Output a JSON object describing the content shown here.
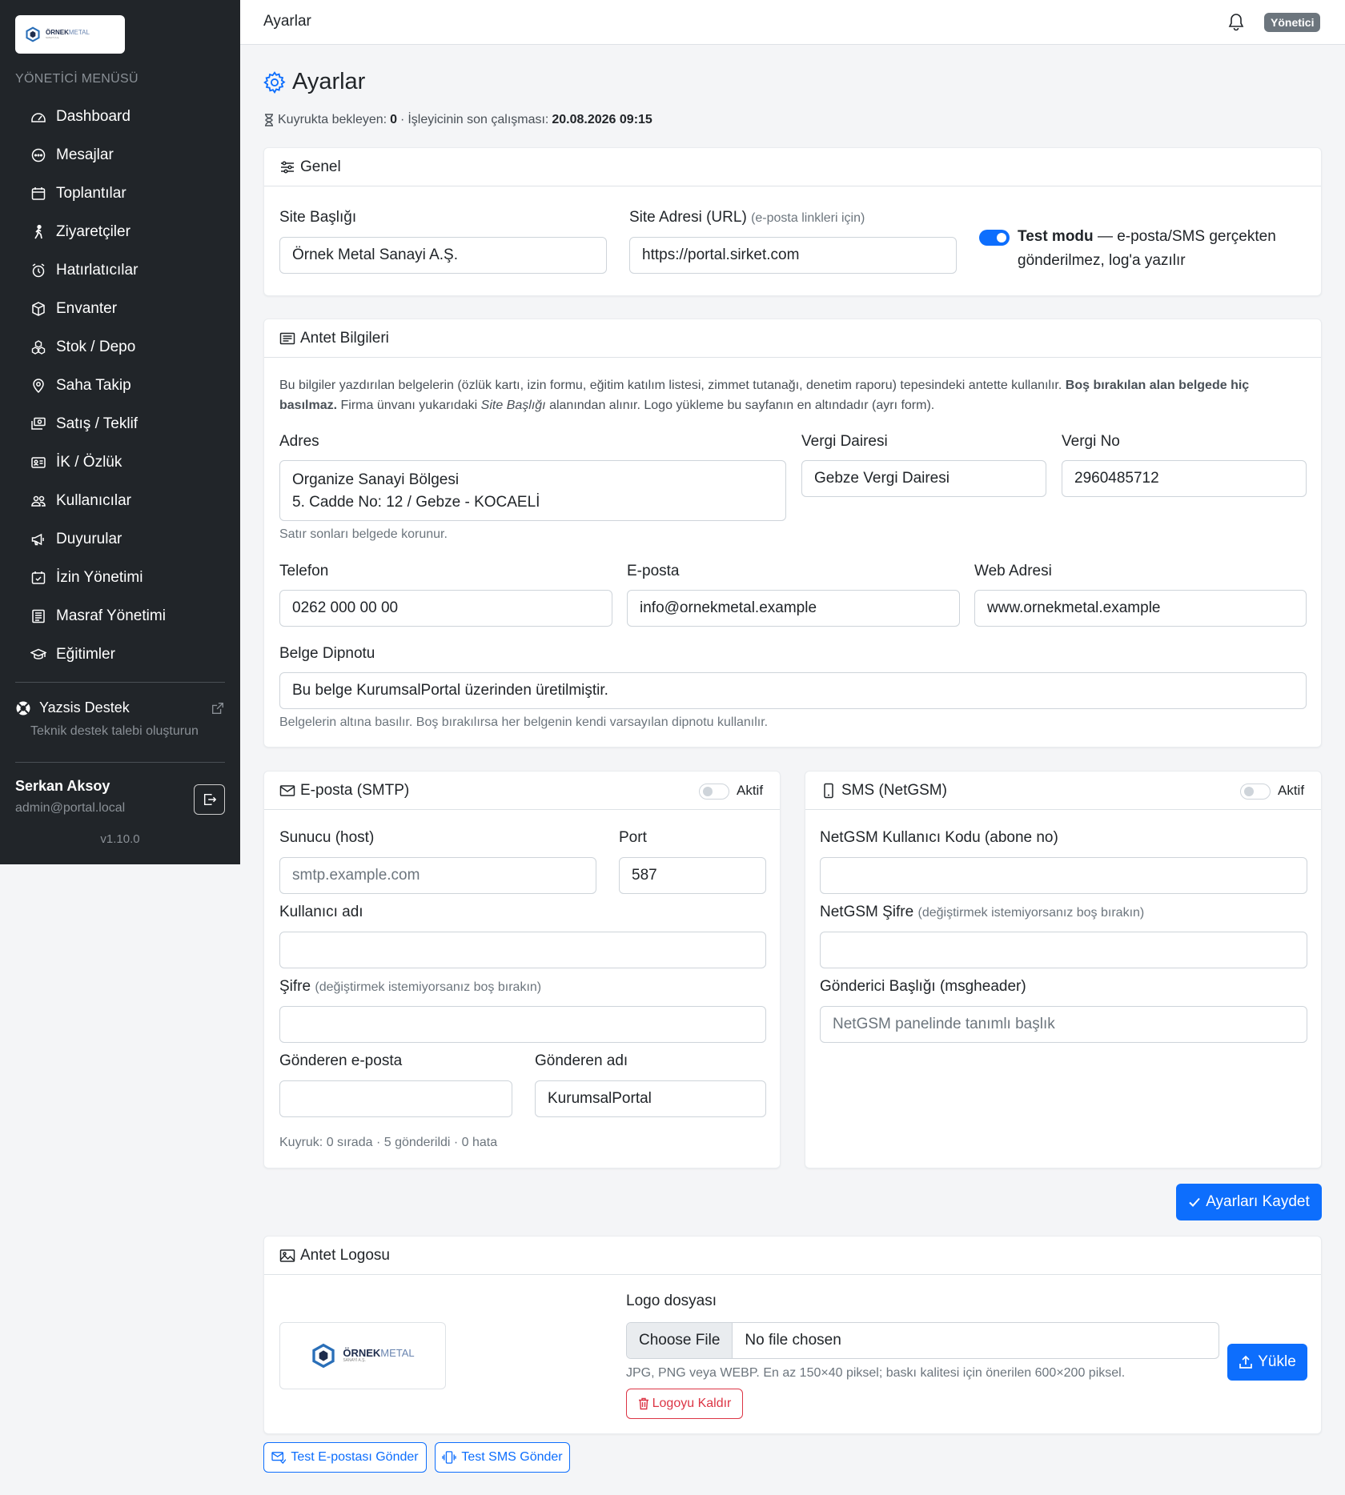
{
  "sidebar": {
    "logo": {
      "brand": "ÖRNEK",
      "brand2": "METAL",
      "tagline": "SANAYİ A.Ş."
    },
    "heading": "YÖNETİCİ MENÜSÜ",
    "items": [
      {
        "label": "Dashboard",
        "icon": "speedometer-icon"
      },
      {
        "label": "Mesajlar",
        "icon": "chat-icon"
      },
      {
        "label": "Toplantılar",
        "icon": "calendar-icon"
      },
      {
        "label": "Ziyaretçiler",
        "icon": "person-walking-icon"
      },
      {
        "label": "Hatırlatıcılar",
        "icon": "alarm-icon"
      },
      {
        "label": "Envanter",
        "icon": "box-icon"
      },
      {
        "label": "Stok / Depo",
        "icon": "boxes-icon"
      },
      {
        "label": "Saha Takip",
        "icon": "geo-pin-icon"
      },
      {
        "label": "Satış / Teklif",
        "icon": "cash-icon"
      },
      {
        "label": "İK / Özlük",
        "icon": "id-card-icon"
      },
      {
        "label": "Kullanıcılar",
        "icon": "people-icon"
      },
      {
        "label": "Duyurular",
        "icon": "megaphone-icon"
      },
      {
        "label": "İzin Yönetimi",
        "icon": "calendar-check-icon"
      },
      {
        "label": "Masraf Yönetimi",
        "icon": "receipt-icon"
      },
      {
        "label": "Eğitimler",
        "icon": "mortarboard-icon"
      }
    ],
    "support": {
      "label": "Yazsis Destek",
      "sub": "Teknik destek talebi oluşturun"
    },
    "user": {
      "name": "Serkan Aksoy",
      "email": "admin@portal.local"
    },
    "version": "v1.10.0"
  },
  "topbar": {
    "title": "Ayarlar",
    "role": "Yönetici"
  },
  "page": {
    "title": "Ayarlar",
    "queue": {
      "waiting_label": "Kuyrukta bekleyen:",
      "waiting": "0",
      "sep": "·",
      "last_run_label": "İşleyicinin son çalışması:",
      "last_run": "20.08.2026 09:15"
    }
  },
  "general": {
    "header": "Genel",
    "site_title_label": "Site Başlığı",
    "site_title": "Örnek Metal Sanayi A.Ş.",
    "site_url_label": "Site Adresi (URL)",
    "site_url_hint": "(e-posta linkleri için)",
    "site_url": "https://portal.sirket.com",
    "test_mode_bold": "Test modu",
    "test_mode_text": "— e-posta/SMS gerçekten gönderilmez, log'a yazılır",
    "test_mode_on": true
  },
  "letterhead": {
    "header": "Antet Bilgileri",
    "intro_1": "Bu bilgiler yazdırılan belgelerin (özlük kartı, izin formu, eğitim katılım listesi, zimmet tutanağı, denetim raporu) tepesindeki antette kullanılır.",
    "intro_bold": "Boş bırakılan alan belgede hiç basılmaz.",
    "intro_2": "Firma ünvanı yukarıdaki",
    "intro_em": "Site Başlığı",
    "intro_3": "alanından alınır. Logo yükleme bu sayfanın en altındadır (ayrı form).",
    "address_label": "Adres",
    "address_line1": "Organize Sanayi Bölgesi",
    "address_line2": "5. Cadde No: 12 / Gebze - KOCAELİ",
    "address_help": "Satır sonları belgede korunur.",
    "tax_office_label": "Vergi Dairesi",
    "tax_office": "Gebze Vergi Dairesi",
    "tax_no_label": "Vergi No",
    "tax_no": "2960485712",
    "phone_label": "Telefon",
    "phone": "0262 000 00 00",
    "email_label": "E-posta",
    "email": "info@ornekmetal.example",
    "web_label": "Web Adresi",
    "web": "www.ornekmetal.example",
    "footer_label": "Belge Dipnotu",
    "footer": "Bu belge KurumsalPortal üzerinden üretilmiştir.",
    "footer_help": "Belgelerin altına basılır. Boş bırakılırsa her belgenin kendi varsayılan dipnotu kullanılır."
  },
  "smtp": {
    "header": "E-posta (SMTP)",
    "active_label": "Aktif",
    "active": false,
    "host_label": "Sunucu (host)",
    "host_placeholder": "smtp.example.com",
    "port_label": "Port",
    "port": "587",
    "user_label": "Kullanıcı adı",
    "user": "",
    "pass_label": "Şifre",
    "pass_hint": "(değiştirmek istemiyorsanız boş bırakın)",
    "from_email_label": "Gönderen e-posta",
    "from_email": "",
    "from_name_label": "Gönderen adı",
    "from_name": "KurumsalPortal",
    "queue_status": "Kuyruk: 0 sırada · 5 gönderildi · 0 hata"
  },
  "sms": {
    "header": "SMS (NetGSM)",
    "active_label": "Aktif",
    "active": false,
    "user_label": "NetGSM Kullanıcı Kodu (abone no)",
    "user": "",
    "pass_label": "NetGSM Şifre",
    "pass_hint": "(değiştirmek istemiyorsanız boş bırakın)",
    "header_label": "Gönderici Başlığı (msgheader)",
    "header_placeholder": "NetGSM panelinde tanımlı başlık"
  },
  "save_button": "Ayarları Kaydet",
  "logo_card": {
    "header": "Antet Logosu",
    "file_label": "Logo dosyası",
    "choose_file": "Choose File",
    "no_file": "No file chosen",
    "help": "JPG, PNG veya WEBP. En az 150×40 piksel; baskı kalitesi için önerilen 600×200 piksel.",
    "remove_button": "Logoyu Kaldır",
    "upload_button": "Yükle"
  },
  "test_email_button": "Test E-postası Gönder",
  "test_sms_button": "Test SMS Gönder",
  "colors": {
    "primary": "#0d6efd",
    "sidebar": "#212529",
    "danger": "#dc3545",
    "badge": "#6c757d"
  }
}
